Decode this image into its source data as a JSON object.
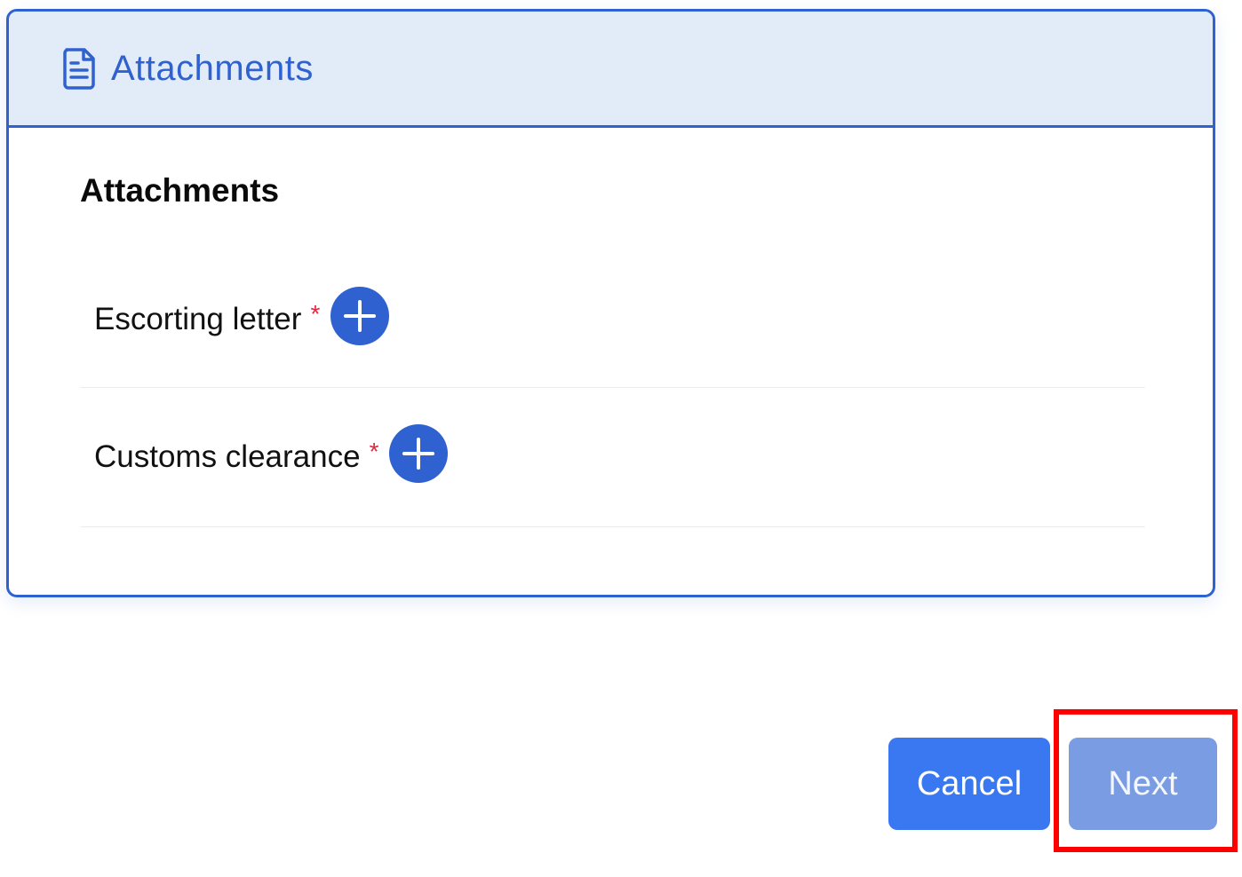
{
  "panel": {
    "header_title": "Attachments",
    "header_icon": "document-icon",
    "section_title": "Attachments",
    "attachments": [
      {
        "label": "Escorting letter",
        "required_mark": "*"
      },
      {
        "label": "Customs clearance",
        "required_mark": "*"
      }
    ]
  },
  "footer": {
    "cancel_label": "Cancel",
    "next_label": "Next"
  },
  "colors": {
    "primary": "#2f62d0",
    "header_bg": "#e1ecf8",
    "required": "#e0283c",
    "cancel_bg": "#3a78f2",
    "next_bg_disabled": "#7a9ce3",
    "highlight": "#ff0000"
  }
}
